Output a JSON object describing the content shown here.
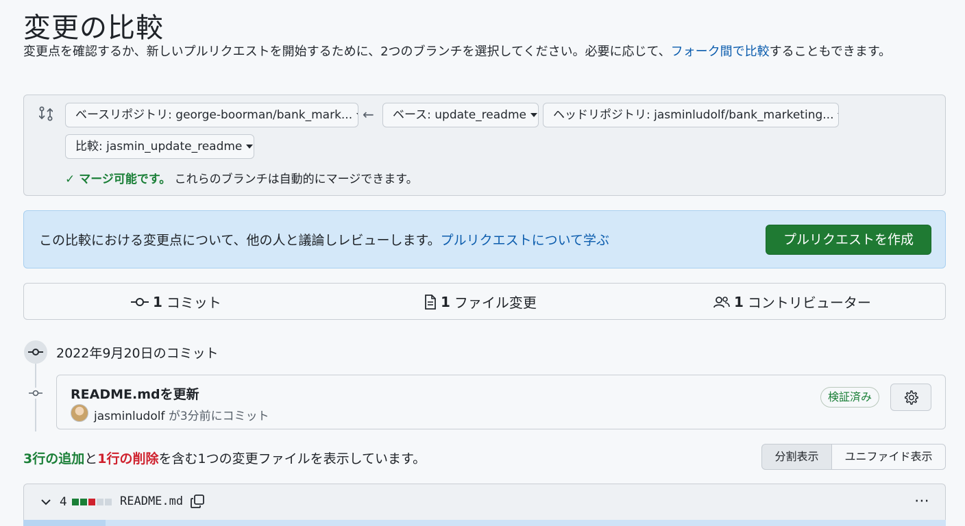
{
  "page": {
    "title": "変更の比較",
    "description_text": "変更点を確認するか、新しいプルリクエストを開始するために、2つのブランチを選択してください。必要に応じて、",
    "description_link": "フォーク間で比較",
    "description_tail": "することもできます。"
  },
  "range": {
    "base_repo": "ベースリポジトリ: george-boorman/bank_mark...",
    "base_branch": "ベース: update_readme",
    "head_repo": "ヘッドリポジトリ: jasminludolf/bank_marketing...",
    "compare_branch": "比較: jasmin_update_readme",
    "merge_status_strong": "マージ可能です。",
    "merge_status_text": "これらのブランチは自動的にマージできます。"
  },
  "info": {
    "text": "この比較における変更点について、他の人と議論しレビューします。",
    "link": "プルリクエストについて学ぶ",
    "create_button": "プルリクエストを作成"
  },
  "stats": {
    "commits_count": "1",
    "commits_label": "コミット",
    "files_count": "1",
    "files_label": "ファイル変更",
    "contributors_count": "1",
    "contributors_label": "コントリビューター"
  },
  "commits": {
    "date_label": "2022年9月20日のコミット",
    "message": "README.mdを更新",
    "author": "jasminludolf",
    "time_text": " が3分前にコミット",
    "verified": "検証済み"
  },
  "summary": {
    "additions": "3行の追加",
    "and": "と",
    "deletions": "1行の削除",
    "rest": "を含む1つの変更ファイルを表示しています。",
    "split_label": "分割表示",
    "unified_label": "ユニファイド表示"
  },
  "file": {
    "change_count": "4",
    "name": "README.md",
    "diffstat": [
      "add",
      "add",
      "del",
      "neutral",
      "neutral"
    ]
  },
  "colors": {
    "primary_button": "#1f7a33",
    "link": "#0b5cad",
    "addition": "#1a7f37",
    "deletion": "#cf222e"
  },
  "icons": [
    "compare-icon",
    "arrow-left-icon",
    "check-icon",
    "commit-icon",
    "file-icon",
    "people-icon",
    "gear-icon",
    "chevron-down-icon",
    "copy-icon",
    "kebab-icon"
  ]
}
